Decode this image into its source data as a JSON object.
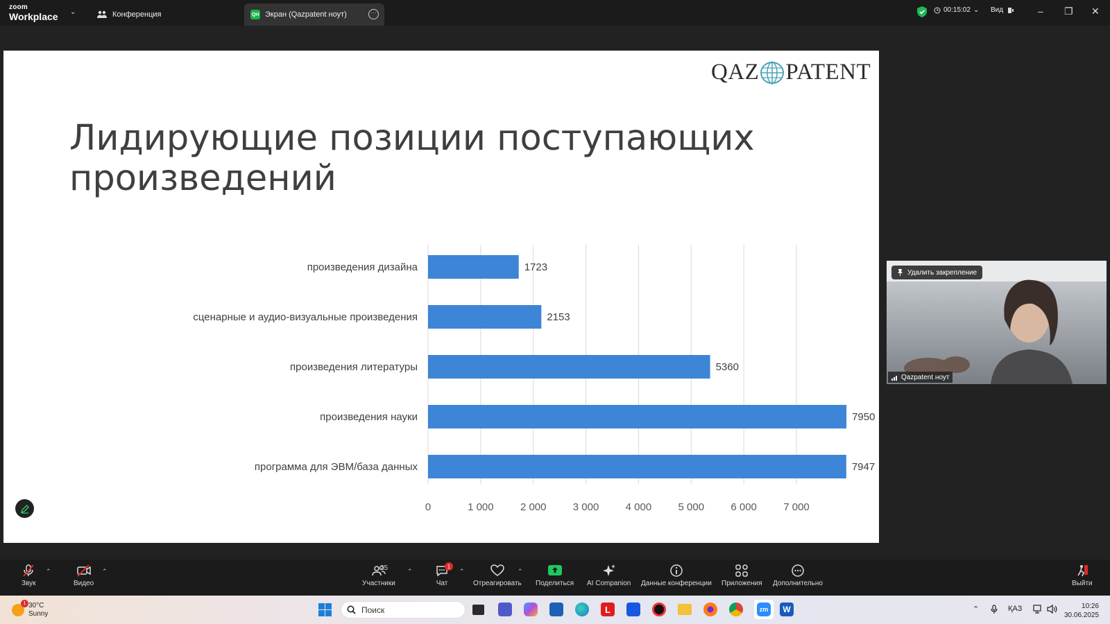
{
  "titlebar": {
    "brand_small": "zoom",
    "brand_large": "Workplace",
    "tab_meeting": "Конференция",
    "tab_screen": "Экран (Qazpatent ноут)",
    "timer": "00:15:02",
    "view": "Вид"
  },
  "slide": {
    "logo_left": "QAZ",
    "logo_right": "PATENT",
    "title_line1": "Лидирующие позиции поступающих",
    "title_line2": "произведений"
  },
  "chart_data": {
    "type": "bar",
    "orientation": "horizontal",
    "categories": [
      "произведения дизайна",
      "сценарные и аудио-визуальные произведения",
      "произведения литературы",
      "произведения науки",
      "программа для ЭВМ/база данных"
    ],
    "values": [
      1723,
      2153,
      5360,
      7950,
      7947
    ],
    "value_labels": [
      "1723",
      "2153",
      "5360",
      "7950",
      "7947"
    ],
    "xlim": [
      0,
      7000
    ],
    "xticks": [
      0,
      1000,
      2000,
      3000,
      4000,
      5000,
      6000,
      7000
    ],
    "xtick_labels": [
      "0",
      "1 000",
      "2 000",
      "3 000",
      "4 000",
      "5 000",
      "6 000",
      "7 000"
    ],
    "grid": true,
    "bar_color": "#3d85d6"
  },
  "video": {
    "unpin_label": "Удалить закрепление",
    "participant_name": "Qazpatent ноут"
  },
  "toolbar": {
    "audio": "Звук",
    "video": "Видео",
    "participants": "Участники",
    "participants_count": "25",
    "chat": "Чат",
    "chat_badge": "1",
    "react": "Отреагировать",
    "share": "Поделиться",
    "ai": "AI Companion",
    "info": "Данные конференции",
    "apps": "Приложения",
    "more": "Дополнительно",
    "leave": "Выйти"
  },
  "taskbar": {
    "temperature": "30°C",
    "weather": "Sunny",
    "weather_badge": "1",
    "search_placeholder": "Поиск",
    "language": "ҚАЗ",
    "time": "10:26",
    "date": "30.06.2025"
  },
  "colors": {
    "accent_green": "#19b34a",
    "share_green": "#22c55e",
    "badge_red": "#e02828",
    "bar_blue": "#3d85d6"
  }
}
